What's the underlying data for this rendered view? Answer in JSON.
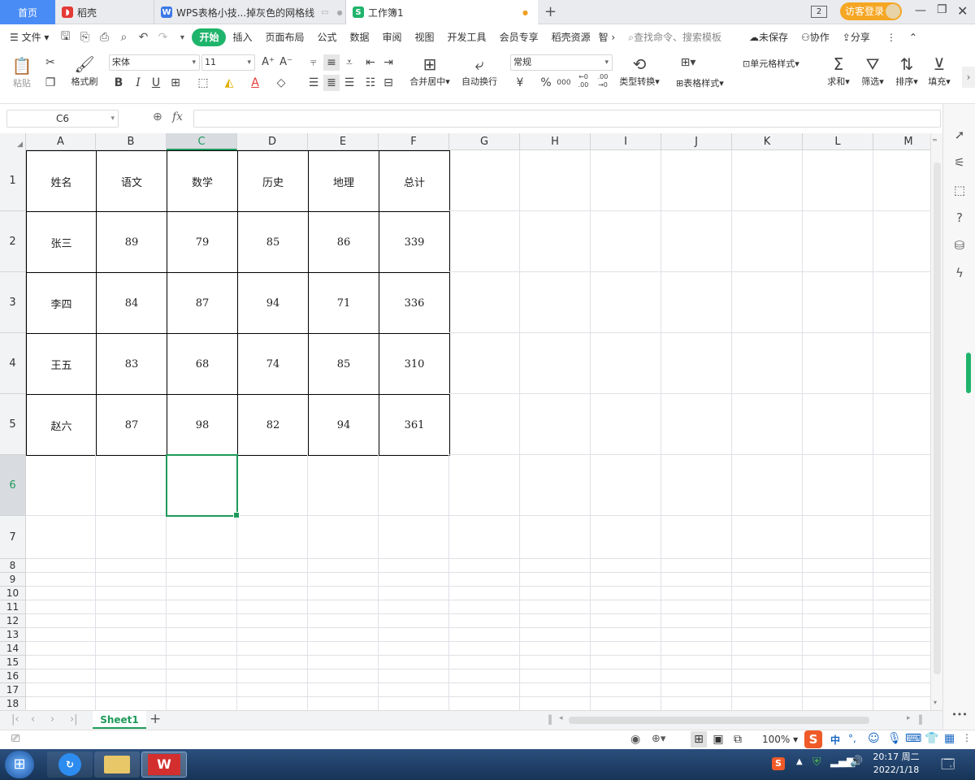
{
  "tabs": [
    {
      "label": "首页"
    },
    {
      "label": "稻壳"
    },
    {
      "label": "WPS表格小技...掉灰色的网格线"
    },
    {
      "label": "工作簿1"
    }
  ],
  "tab_badge": "2",
  "login_label": "访客登录",
  "menu": {
    "file": "文件",
    "items": [
      "开始",
      "插入",
      "页面布局",
      "公式",
      "数据",
      "审阅",
      "视图",
      "开发工具",
      "会员专享",
      "稻壳资源",
      "智"
    ],
    "search_placeholder": "查找命令、搜索模板",
    "unsaved": "未保存",
    "collab": "协作",
    "share": "分享"
  },
  "ribbon": {
    "paste": "粘贴",
    "format_painter": "格式刷",
    "font_name": "宋体",
    "font_size": "11",
    "bold": "B",
    "italic": "I",
    "underline": "U",
    "font_color_letter": "A",
    "merge_center": "合并居中",
    "auto_wrap": "自动换行",
    "number_format": "常规",
    "currency": "¥",
    "percent": "%",
    "thousands": "000",
    "inc_decimal": "←0\n.00",
    "dec_decimal": ".00\n→0",
    "type_convert": "类型转换",
    "conditional_format": "",
    "table_style": "表格样式",
    "cell_style": "单元格样式",
    "sum": "求和",
    "filter": "筛选",
    "sort": "排序",
    "fill": "填充"
  },
  "formula_bar": {
    "name_box": "C6",
    "fx": "fx",
    "value": ""
  },
  "columns": [
    "A",
    "B",
    "C",
    "D",
    "E",
    "F",
    "G",
    "H",
    "I",
    "J",
    "K",
    "L",
    "M"
  ],
  "rows": [
    "1",
    "2",
    "3",
    "4",
    "5",
    "6",
    "7",
    "8",
    "9",
    "10",
    "11",
    "12",
    "13",
    "14",
    "15",
    "16",
    "17",
    "18"
  ],
  "table": {
    "header": [
      "姓名",
      "语文",
      "数学",
      "历史",
      "地理",
      "总计"
    ],
    "data": [
      [
        "张三",
        "89",
        "79",
        "85",
        "86",
        "339"
      ],
      [
        "李四",
        "84",
        "87",
        "94",
        "71",
        "336"
      ],
      [
        "王五",
        "83",
        "68",
        "74",
        "85",
        "310"
      ],
      [
        "赵六",
        "87",
        "98",
        "82",
        "94",
        "361"
      ]
    ]
  },
  "selected_cell": "C6",
  "sheet_tab": "Sheet1",
  "status": {
    "zoom": "100%"
  },
  "taskbar": {
    "time": "20:17 周二",
    "date": "2022/1/18",
    "ime": "中"
  },
  "colors": {
    "accent_green": "#1fb46b",
    "selection": "#1e9a5a",
    "home_tab": "#4a8cf6",
    "login_btn": "#f5a623"
  }
}
